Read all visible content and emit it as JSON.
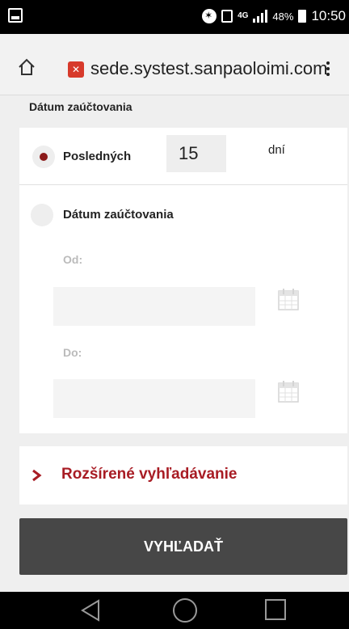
{
  "status_bar": {
    "network": "4G",
    "battery": "48%",
    "time": "10:50"
  },
  "browser": {
    "url": "sede.systest.sanpaoloimi.com"
  },
  "filter": {
    "section_title": "Dátum zaúčtovania",
    "option_last": {
      "label": "Posledných",
      "value": "15",
      "unit": "dní",
      "selected": true
    },
    "option_date": {
      "label": "Dátum zaúčtovania",
      "selected": false
    },
    "from_label": "Od:",
    "to_label": "Do:"
  },
  "advanced": {
    "label": "Rozšírené vyhľadávanie"
  },
  "search_button": {
    "label": "VYHĽADAŤ"
  },
  "colors": {
    "accent": "#a81c24",
    "radio_selected": "#8b1a1a",
    "button": "#474747"
  }
}
